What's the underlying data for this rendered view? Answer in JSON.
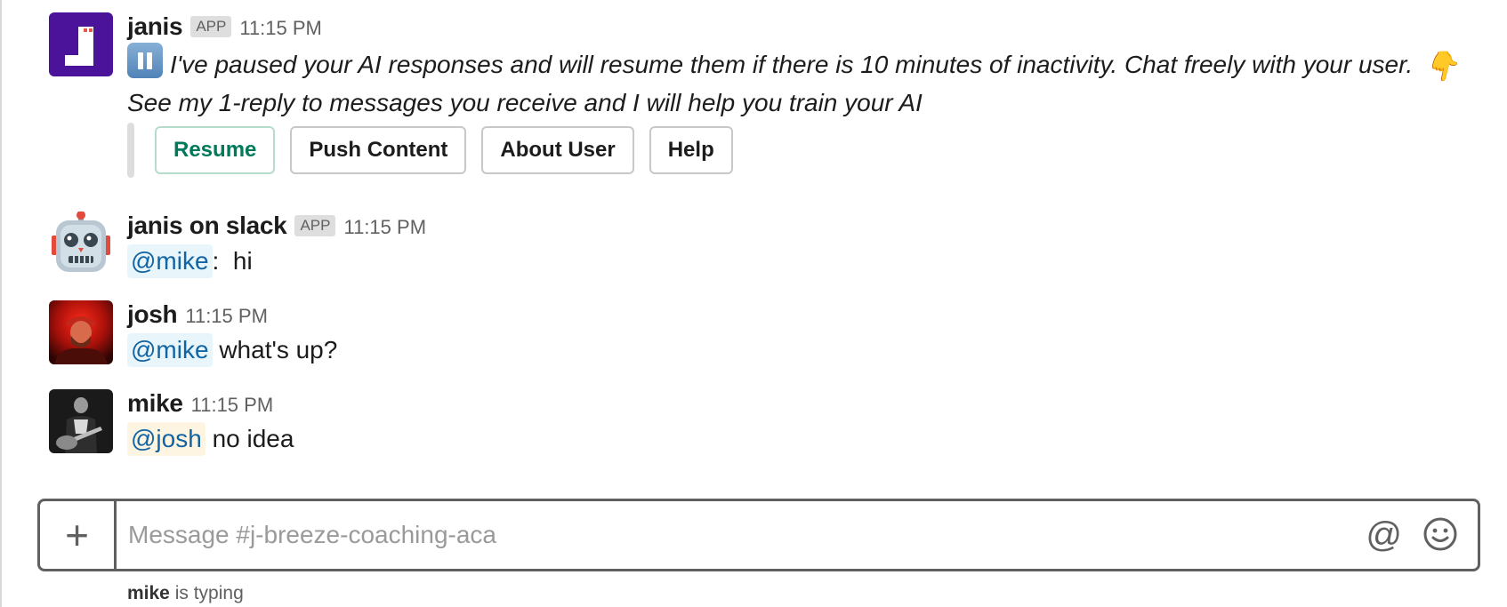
{
  "messages": [
    {
      "sender": "janis",
      "badge": "APP",
      "time": "11:15 PM",
      "avatar_icon": "janis-logo-icon",
      "text_line1": "I've paused your AI responses and will resume them if there is 10 minutes of inactivity. Chat freely with your user.",
      "text_line2": "See my 1-reply to messages you receive and I will help you train your AI",
      "buttons": [
        "Resume",
        "Push Content",
        "About User",
        "Help"
      ]
    },
    {
      "sender": "janis on slack",
      "badge": "APP",
      "time": "11:15 PM",
      "avatar_icon": "robot-face-icon",
      "mention": "@mike",
      "text": ":  hi"
    },
    {
      "sender": "josh",
      "time": "11:15 PM",
      "mention": "@mike",
      "text": " what's up?"
    },
    {
      "sender": "mike",
      "time": "11:15 PM",
      "mention": "@josh",
      "text": " no idea"
    }
  ],
  "composer": {
    "placeholder": "Message #j-breeze-coaching-aca"
  },
  "typing": {
    "user": "mike",
    "suffix": " is typing"
  },
  "colors": {
    "janis_brand": "#4a1399",
    "mention_bg": "#e8f5fa",
    "mention_self_bg": "#fdf5e2",
    "mention_text": "#1264a3",
    "resume_green": "#007a5a"
  }
}
